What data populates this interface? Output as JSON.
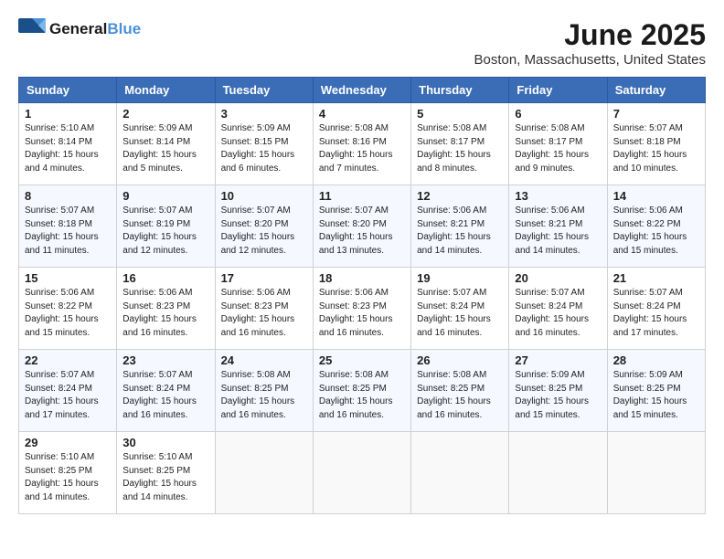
{
  "logo": {
    "general": "General",
    "blue": "Blue"
  },
  "title": "June 2025",
  "location": "Boston, Massachusetts, United States",
  "days_of_week": [
    "Sunday",
    "Monday",
    "Tuesday",
    "Wednesday",
    "Thursday",
    "Friday",
    "Saturday"
  ],
  "weeks": [
    [
      {
        "day": "1",
        "info": "Sunrise: 5:10 AM\nSunset: 8:14 PM\nDaylight: 15 hours\nand 4 minutes."
      },
      {
        "day": "2",
        "info": "Sunrise: 5:09 AM\nSunset: 8:14 PM\nDaylight: 15 hours\nand 5 minutes."
      },
      {
        "day": "3",
        "info": "Sunrise: 5:09 AM\nSunset: 8:15 PM\nDaylight: 15 hours\nand 6 minutes."
      },
      {
        "day": "4",
        "info": "Sunrise: 5:08 AM\nSunset: 8:16 PM\nDaylight: 15 hours\nand 7 minutes."
      },
      {
        "day": "5",
        "info": "Sunrise: 5:08 AM\nSunset: 8:17 PM\nDaylight: 15 hours\nand 8 minutes."
      },
      {
        "day": "6",
        "info": "Sunrise: 5:08 AM\nSunset: 8:17 PM\nDaylight: 15 hours\nand 9 minutes."
      },
      {
        "day": "7",
        "info": "Sunrise: 5:07 AM\nSunset: 8:18 PM\nDaylight: 15 hours\nand 10 minutes."
      }
    ],
    [
      {
        "day": "8",
        "info": "Sunrise: 5:07 AM\nSunset: 8:18 PM\nDaylight: 15 hours\nand 11 minutes."
      },
      {
        "day": "9",
        "info": "Sunrise: 5:07 AM\nSunset: 8:19 PM\nDaylight: 15 hours\nand 12 minutes."
      },
      {
        "day": "10",
        "info": "Sunrise: 5:07 AM\nSunset: 8:20 PM\nDaylight: 15 hours\nand 12 minutes."
      },
      {
        "day": "11",
        "info": "Sunrise: 5:07 AM\nSunset: 8:20 PM\nDaylight: 15 hours\nand 13 minutes."
      },
      {
        "day": "12",
        "info": "Sunrise: 5:06 AM\nSunset: 8:21 PM\nDaylight: 15 hours\nand 14 minutes."
      },
      {
        "day": "13",
        "info": "Sunrise: 5:06 AM\nSunset: 8:21 PM\nDaylight: 15 hours\nand 14 minutes."
      },
      {
        "day": "14",
        "info": "Sunrise: 5:06 AM\nSunset: 8:22 PM\nDaylight: 15 hours\nand 15 minutes."
      }
    ],
    [
      {
        "day": "15",
        "info": "Sunrise: 5:06 AM\nSunset: 8:22 PM\nDaylight: 15 hours\nand 15 minutes."
      },
      {
        "day": "16",
        "info": "Sunrise: 5:06 AM\nSunset: 8:23 PM\nDaylight: 15 hours\nand 16 minutes."
      },
      {
        "day": "17",
        "info": "Sunrise: 5:06 AM\nSunset: 8:23 PM\nDaylight: 15 hours\nand 16 minutes."
      },
      {
        "day": "18",
        "info": "Sunrise: 5:06 AM\nSunset: 8:23 PM\nDaylight: 15 hours\nand 16 minutes."
      },
      {
        "day": "19",
        "info": "Sunrise: 5:07 AM\nSunset: 8:24 PM\nDaylight: 15 hours\nand 16 minutes."
      },
      {
        "day": "20",
        "info": "Sunrise: 5:07 AM\nSunset: 8:24 PM\nDaylight: 15 hours\nand 16 minutes."
      },
      {
        "day": "21",
        "info": "Sunrise: 5:07 AM\nSunset: 8:24 PM\nDaylight: 15 hours\nand 17 minutes."
      }
    ],
    [
      {
        "day": "22",
        "info": "Sunrise: 5:07 AM\nSunset: 8:24 PM\nDaylight: 15 hours\nand 17 minutes."
      },
      {
        "day": "23",
        "info": "Sunrise: 5:07 AM\nSunset: 8:24 PM\nDaylight: 15 hours\nand 16 minutes."
      },
      {
        "day": "24",
        "info": "Sunrise: 5:08 AM\nSunset: 8:25 PM\nDaylight: 15 hours\nand 16 minutes."
      },
      {
        "day": "25",
        "info": "Sunrise: 5:08 AM\nSunset: 8:25 PM\nDaylight: 15 hours\nand 16 minutes."
      },
      {
        "day": "26",
        "info": "Sunrise: 5:08 AM\nSunset: 8:25 PM\nDaylight: 15 hours\nand 16 minutes."
      },
      {
        "day": "27",
        "info": "Sunrise: 5:09 AM\nSunset: 8:25 PM\nDaylight: 15 hours\nand 15 minutes."
      },
      {
        "day": "28",
        "info": "Sunrise: 5:09 AM\nSunset: 8:25 PM\nDaylight: 15 hours\nand 15 minutes."
      }
    ],
    [
      {
        "day": "29",
        "info": "Sunrise: 5:10 AM\nSunset: 8:25 PM\nDaylight: 15 hours\nand 14 minutes."
      },
      {
        "day": "30",
        "info": "Sunrise: 5:10 AM\nSunset: 8:25 PM\nDaylight: 15 hours\nand 14 minutes."
      },
      {
        "day": "",
        "info": ""
      },
      {
        "day": "",
        "info": ""
      },
      {
        "day": "",
        "info": ""
      },
      {
        "day": "",
        "info": ""
      },
      {
        "day": "",
        "info": ""
      }
    ]
  ]
}
